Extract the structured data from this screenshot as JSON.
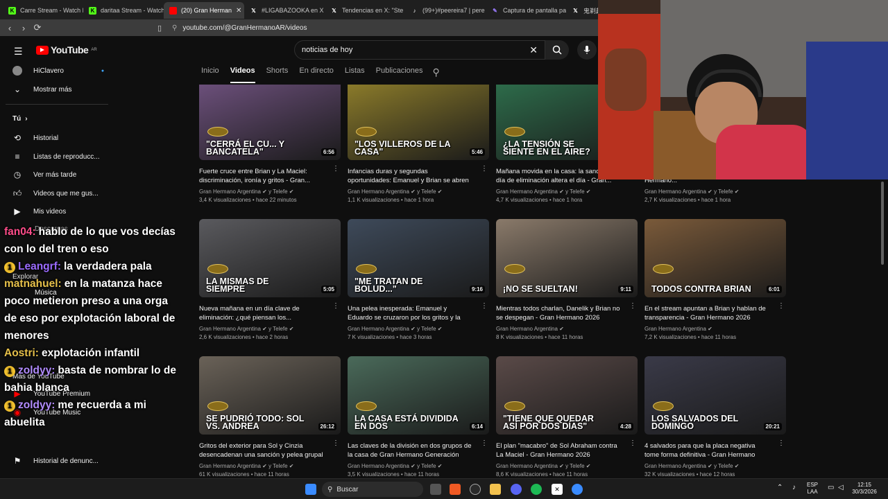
{
  "browser": {
    "tabs": [
      {
        "label": "Carre Stream - Watch L",
        "icon": "kick-icon",
        "color": "#53fc18"
      },
      {
        "label": "daritaa Stream - Watch",
        "icon": "kick-icon",
        "color": "#53fc18"
      },
      {
        "label": "(20) Gran Herman",
        "icon": "youtube-icon",
        "color": "#ff0000",
        "active": true
      },
      {
        "label": "#LIGABAZOOKA en X",
        "icon": "x-icon",
        "color": "#ffffff"
      },
      {
        "label": "Tendencias en X: \"Ste",
        "icon": "x-icon",
        "color": "#ffffff"
      },
      {
        "label": "(99+)#peereira7 | pere",
        "icon": "tiktok-icon",
        "color": "#ffffff"
      },
      {
        "label": "Captura de pantalla pa",
        "icon": "pen-icon",
        "color": "#9b7bff"
      },
      {
        "label": "鬼剃起寺",
        "icon": "x-icon",
        "color": "#ffffff"
      }
    ],
    "url": "youtube.com/@GranHermanoAR/videos"
  },
  "youtube": {
    "logo": "YouTube",
    "region": "AR",
    "search_value": "noticias de hoy",
    "sidebar": {
      "top": [
        {
          "label": "HiClavero",
          "icon": "avatar-icon"
        },
        {
          "label": "Mostrar más",
          "icon": "chevron-down-icon"
        }
      ],
      "you_header": "Tú",
      "you_items": [
        {
          "label": "Historial",
          "icon": "history-icon"
        },
        {
          "label": "Listas de reproducc...",
          "icon": "playlist-icon"
        },
        {
          "label": "Ver más tarde",
          "icon": "clock-icon"
        },
        {
          "label": "Videos que me gus...",
          "icon": "thumbs-up-icon"
        },
        {
          "label": "Mis videos",
          "icon": "video-icon"
        }
      ],
      "lower_items": [
        {
          "label": "Descargas"
        },
        {
          "label": "Explorar"
        },
        {
          "label": "Música"
        },
        {
          "label": "Más de YouTube"
        },
        {
          "label": "YouTube Premium"
        },
        {
          "label": "YouTube Music"
        },
        {
          "label": "Historial de denunc..."
        }
      ]
    },
    "channel_tabs": [
      "Inicio",
      "Videos",
      "Shorts",
      "En directo",
      "Listas",
      "Publicaciones"
    ],
    "active_tab": "Videos",
    "videos": [
      {
        "caption": "\"CERRÁ EL CU... Y BANCATELA\"",
        "duration": "6:56",
        "title": "Fuerte cruce entre Brian y La Maciel: discriminación, ironía y gritos - Gran...",
        "channel": "Gran Hermano Argentina",
        "partner": "y Telefe",
        "stats": "3,4 K visualizaciones • hace 22 minutos",
        "bg": "#6b4f7a"
      },
      {
        "caption": "\"LOS VILLEROS DE LA CASA\"",
        "duration": "5:46",
        "title": "Infancias duras y segundas oportunidades: Emanuel y Brian se abren como nunca - Gr...",
        "channel": "Gran Hermano Argentina",
        "partner": "y Telefe",
        "stats": "1,1 K visualizaciones • hace 1 hora",
        "bg": "#8a7a2a"
      },
      {
        "caption": "¿LA TENSIÓN SE SIENTE EN EL AIRE?",
        "duration": "",
        "title": "Mañana movida en la casa: la sanción y el día de eliminación altera el día - Gran...",
        "channel": "Gran Hermano Argentina",
        "partner": "y Telefe",
        "stats": "4,7 K visualizaciones • hace 1 hora",
        "bg": "#2d6b4a"
      },
      {
        "caption": "",
        "duration": "",
        "title": "...de los gritos por la sanción - Gran Hermano...",
        "channel": "Gran Hermano Argentina",
        "partner": "y Telefe",
        "stats": "2,7 K visualizaciones • hace 1 hora",
        "bg": "#3a3a3a"
      },
      {
        "caption": "LA MISMAS DE SIEMPRE",
        "duration": "5:05",
        "title": "Nueva mañana en un día clave de eliminación: ¿qué piensan los...",
        "channel": "Gran Hermano Argentina",
        "partner": "y Telefe",
        "stats": "2,6 K visualizaciones • hace 2 horas",
        "bg": "#5a5a5e"
      },
      {
        "caption": "\"ME TRATAN DE BOLUD...\"",
        "duration": "9:16",
        "title": "Una pelea inesperada: Emanuel y Eduardo se cruzaron por los gritos y la sanción - Gran...",
        "channel": "Gran Hermano Argentina",
        "partner": "y Telefe",
        "stats": "7 K visualizaciones • hace 3 horas",
        "bg": "#3e4a5a"
      },
      {
        "caption": "¡NO SE SUELTAN!",
        "duration": "9:11",
        "title": "Mientras todos charlan, Danelik y Brian no se despegan - Gran Hermano 2026",
        "channel": "Gran Hermano Argentina",
        "partner": "",
        "stats": "8 K visualizaciones • hace 11 horas",
        "bg": "#8a7a6a"
      },
      {
        "caption": "TODOS CONTRA BRIAN",
        "duration": "6:01",
        "title": "En el stream apuntan a Brian y hablan de transparencia - Gran Hermano 2026",
        "channel": "Gran Hermano Argentina",
        "partner": "",
        "stats": "7,2 K visualizaciones • hace 11 horas",
        "bg": "#7a5a3a"
      },
      {
        "caption": "SE PUDRIÓ TODO: SOL VS. ANDREA",
        "duration": "26:12",
        "title": "Gritos del exterior para Sol y Cinzia desencadenan una sanción y pelea grupal -...",
        "channel": "Gran Hermano Argentina",
        "partner": "y Telefe",
        "stats": "61 K visualizaciones • hace 11 horas",
        "bg": "#6a6258"
      },
      {
        "caption": "LA CASA ESTÁ DIVIDIDA EN DOS",
        "duration": "6:14",
        "title": "Las claves de la división en dos grupos de la casa de Gran Hermano Generación Dorada",
        "channel": "Gran Hermano Argentina",
        "partner": "y Telefe",
        "stats": "3,5 K visualizaciones • hace 11 horas",
        "bg": "#4a6a5a"
      },
      {
        "caption": "\"TIENE QUE QUEDAR ASÍ POR DOS DÍAS\"",
        "duration": "4:28",
        "title": "El plan \"macabro\" de Sol Abraham contra La Maciel - Gran Hermano 2026",
        "channel": "Gran Hermano Argentina",
        "partner": "y Telefe",
        "stats": "8,6 K visualizaciones • hace 11 horas",
        "bg": "#5a4a48"
      },
      {
        "caption": "LOS SALVADOS DEL DOMINGO",
        "duration": "20:21",
        "title": "4 salvados para que la placa negativa tome forma definitiva - Gran Hermano 2026",
        "channel": "Gran Hermano Argentina",
        "partner": "y Telefe",
        "stats": "32 K visualizaciones • hace 12 horas",
        "bg": "#3a3a48"
      }
    ]
  },
  "chat": [
    {
      "user": "fan04:",
      "text": "hablo de lo que vos decías con lo del tren o eso",
      "color": "#ff4d8a"
    },
    {
      "user": "Leangrf:",
      "text": "la verdadera pala",
      "color": "#9b6bff",
      "badge": "1"
    },
    {
      "user": "matnahuel:",
      "text": "en la matanza hace poco metieron preso a una orga de eso por explotación laboral de menores",
      "color": "#e6c04a"
    },
    {
      "user": "Aostri:",
      "text": "explotación infantil",
      "color": "#e6c04a"
    },
    {
      "user": "zoldyy:",
      "text": "basta de nombrar lo de bahia blanca",
      "color": "#b28cff",
      "badge": "1"
    },
    {
      "user": "zoldyy:",
      "text": "me recuerda a mi abuelita",
      "color": "#b28cff",
      "badge": "1"
    }
  ],
  "taskbar": {
    "search_placeholder": "Buscar",
    "lang": "ESP",
    "lang2": "LAA",
    "time": "12:15",
    "date": "30/3/2026"
  }
}
